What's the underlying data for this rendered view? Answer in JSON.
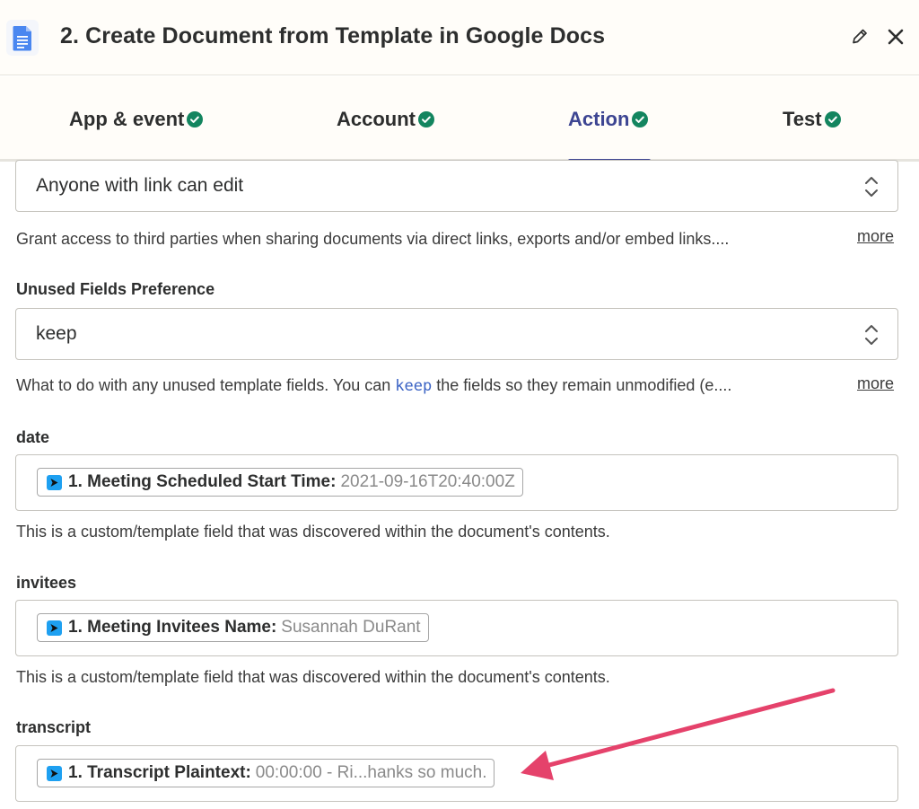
{
  "header": {
    "title": "2. Create Document from Template in Google Docs",
    "app_icon": "google-docs-icon",
    "edit_icon": "pencil-icon",
    "close_icon": "close-icon"
  },
  "tabs": [
    {
      "label": "App & event",
      "status": "complete"
    },
    {
      "label": "Account",
      "status": "complete"
    },
    {
      "label": "Action",
      "status": "complete",
      "active": true
    },
    {
      "label": "Test",
      "status": "complete"
    }
  ],
  "colors": {
    "accent": "#3d4592",
    "check": "#13855f",
    "arrow": "#e5426b",
    "zoom_blue": "#1ea0f1"
  },
  "sharing": {
    "value": "Anyone with link can edit",
    "help": "Grant access to third parties when sharing documents via direct links, exports and/or embed links....",
    "more": "more"
  },
  "unused_fields": {
    "label": "Unused Fields Preference",
    "value": "keep",
    "help_before": "What to do with any unused template fields. You can ",
    "help_code": "keep",
    "help_after": " the fields so they remain unmodified (e....",
    "more": "more"
  },
  "date": {
    "label": "date",
    "pill_key": "1. Meeting Scheduled Start Time:",
    "pill_value": "2021-09-16T20:40:00Z",
    "help": "This is a custom/template field that was discovered within the document's contents."
  },
  "invitees": {
    "label": "invitees",
    "pill_key": "1. Meeting Invitees Name:",
    "pill_value": "Susannah DuRant",
    "help": "This is a custom/template field that was discovered within the document's contents."
  },
  "transcript": {
    "label": "transcript",
    "pill_key": "1. Transcript Plaintext:",
    "pill_value": "00:00:00 - Ri...hanks so much."
  }
}
